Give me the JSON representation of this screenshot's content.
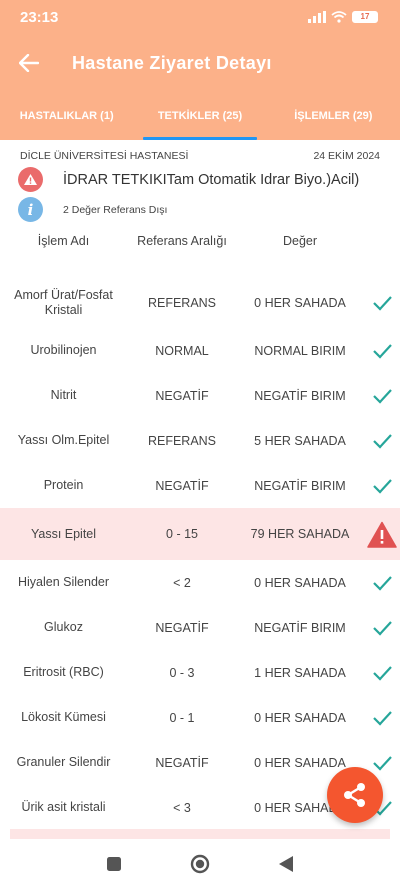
{
  "status_bar": {
    "time": "23:13",
    "battery": "17"
  },
  "app_bar": {
    "title": "Hastane Ziyaret Detayı",
    "back_icon": "arrow-left-icon"
  },
  "tabs": [
    {
      "label": "HASTALIKLAR (1)",
      "active": false
    },
    {
      "label": "TETKİKLER (25)",
      "active": true
    },
    {
      "label": "İŞLEMLER (29)",
      "active": false
    }
  ],
  "visit": {
    "hospital": "DİCLE ÜNİVERSİTESİ HASTANESİ",
    "date": "24 EKİM 2024",
    "test_name": "İDRAR TETKIKITam Otomatik Idrar Biyo.)Acil)",
    "out_of_range_text": "2 Değer Referans Dışı"
  },
  "table": {
    "headers": {
      "name": "İşlem Adı",
      "range": "Referans Aralığı",
      "value": "Değer"
    },
    "rows": [
      {
        "name": "Amorf Ürat/Fosfat Kristali",
        "range": "REFERANS",
        "value": "0 HER SAHADA",
        "status": "normal"
      },
      {
        "name": "Urobilinojen",
        "range": "NORMAL",
        "value": "NORMAL BIRIM",
        "status": "normal"
      },
      {
        "name": "Nitrit",
        "range": "NEGATİF",
        "value": "NEGATİF BIRIM",
        "status": "normal"
      },
      {
        "name": "Yassı Olm.Epitel",
        "range": "REFERANS",
        "value": "5 HER SAHADA",
        "status": "normal"
      },
      {
        "name": "Protein",
        "range": "NEGATİF",
        "value": "NEGATİF BIRIM",
        "status": "normal"
      },
      {
        "name": "Yassı Epitel",
        "range": "0 - 15",
        "value": "79 HER SAHADA",
        "status": "abnormal"
      },
      {
        "name": "Hiyalen Silender",
        "range": "< 2",
        "value": "0 HER SAHADA",
        "status": "normal"
      },
      {
        "name": "Glukoz",
        "range": "NEGATİF",
        "value": "NEGATİF BIRIM",
        "status": "normal"
      },
      {
        "name": "Eritrosit (RBC)",
        "range": "0 - 3",
        "value": "1 HER SAHADA",
        "status": "normal"
      },
      {
        "name": "Lökosit Kümesi",
        "range": "0 - 1",
        "value": "0 HER SAHADA",
        "status": "normal"
      },
      {
        "name": "Granuler Silendir",
        "range": "NEGATİF",
        "value": "0 HER SAHADA",
        "status": "normal"
      },
      {
        "name": "Ürik asit kristali",
        "range": "< 3",
        "value": "0 HER SAHADA",
        "status": "normal"
      }
    ]
  },
  "colors": {
    "header": "#fcb189",
    "check": "#26a69a",
    "warning": "#e05252",
    "fab": "#f4562f",
    "abnormal_row": "#fde5e5"
  },
  "fab": {
    "icon": "share-icon"
  }
}
